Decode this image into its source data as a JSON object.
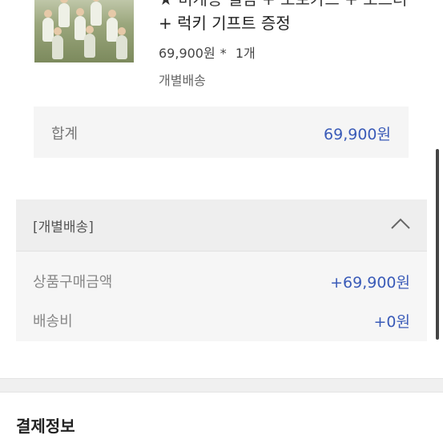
{
  "product": {
    "title_line1": "★ 미개봉 앨범 + 포토카드 + 포스터 ★ 스페셜 굿즈",
    "title_line2": "+ 럭키 기프트 증정",
    "price": "69,900원",
    "quantity_sep": "*",
    "quantity": "1개",
    "shipping_type": "개별배송"
  },
  "total": {
    "label": "합계",
    "value": "69,900원"
  },
  "shipping_group": {
    "header": "[개별배송]",
    "rows": [
      {
        "label": "상품구매금액",
        "value": "+69,900원"
      },
      {
        "label": "배송비",
        "value": "+0원"
      }
    ]
  },
  "payment": {
    "section_title": "결제정보"
  },
  "colors": {
    "accent": "#3a5bb8",
    "panel": "#f5f5f5",
    "header_bg": "#eeeeee"
  },
  "icons": {
    "collapse": "chevron-up-icon"
  }
}
